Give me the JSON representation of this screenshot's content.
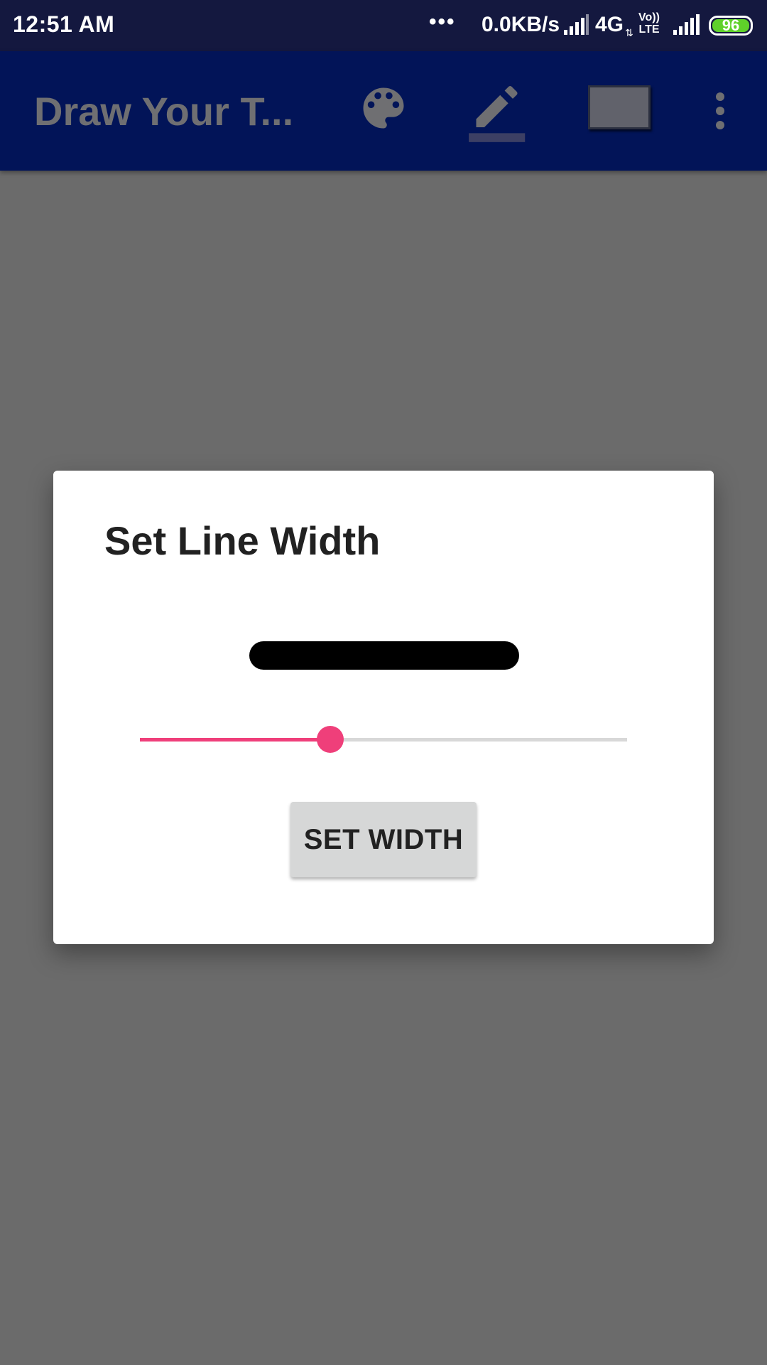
{
  "status_bar": {
    "time": "12:51 AM",
    "dots": "•••",
    "speed": "0.0KB/s",
    "network": "4G",
    "arrows": "⇅",
    "volte_top": "Vo))",
    "volte_bottom": "LTE",
    "battery": "96",
    "battery_color": "#5fd12a"
  },
  "app_bar": {
    "title": "Draw Your T...",
    "icons": [
      "palette-icon",
      "pen-icon",
      "rectangle-icon",
      "overflow-icon"
    ],
    "color": "#021458"
  },
  "dialog": {
    "title": "Set Line Width",
    "slider": {
      "value": 0.39,
      "accent": "#ef3f7a"
    },
    "button_label": "SET WIDTH"
  }
}
